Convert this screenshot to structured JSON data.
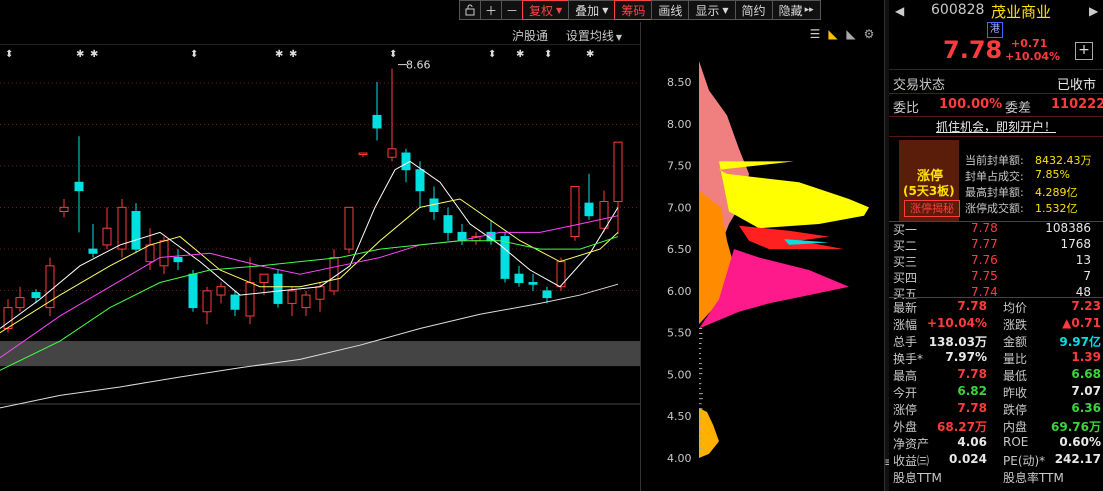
{
  "toolbar": {
    "buttons": [
      {
        "label": "复权",
        "dropdown": true,
        "highlight": true
      },
      {
        "label": "叠加",
        "dropdown": true,
        "highlight": false
      },
      {
        "label": "筹码",
        "dropdown": false,
        "highlight": true
      },
      {
        "label": "画线",
        "dropdown": false,
        "highlight": false
      },
      {
        "label": "显示",
        "dropdown": true,
        "highlight": false
      },
      {
        "label": "简约",
        "dropdown": false,
        "highlight": false
      },
      {
        "label": "隐藏",
        "dropdown": false,
        "highlight": false
      }
    ],
    "more_glyph": "▸▸"
  },
  "chart_header": {
    "hsgt_label": "沪股通",
    "ma_settings_label": "设置均线"
  },
  "annotations": {
    "high_price_label": "8.66"
  },
  "chart_data": {
    "type": "candlestick",
    "price_axis": [
      "8.50",
      "8.00",
      "7.50",
      "7.00",
      "6.50",
      "6.00",
      "5.50",
      "5.00",
      "4.50",
      "4.00"
    ],
    "ylim": [
      3.9,
      8.8
    ],
    "colors": {
      "up": "#ff3b3b",
      "down": "#00e0e0",
      "ma5": "#ffffff",
      "ma10": "#ffff66",
      "ma20": "#ff44ff",
      "ma30": "#44ff44",
      "ma60": "#dddddd",
      "band": "#444444"
    }
  },
  "stock": {
    "code": "600828",
    "name": "茂业商业",
    "tag": "港",
    "price": "7.78",
    "change": "+0.71",
    "change_pct": "+10.04%"
  },
  "status": {
    "label": "交易状态",
    "value": "已收市"
  },
  "order_ratio": {
    "ratio_label": "委比",
    "ratio_value": "100.00%",
    "diff_label": "委差",
    "diff_value": "110222"
  },
  "promo": "抓住机会，即刻开户！",
  "limit_up": {
    "title": "涨停",
    "subtitle": "(5天3板)",
    "button": "涨停揭秘",
    "items": [
      {
        "label": "当前封单额:",
        "value": "8432.43万"
      },
      {
        "label": "封单占成交:",
        "value": "7.85%"
      },
      {
        "label": "最高封单额:",
        "value": "4.289亿"
      },
      {
        "label": "涨停成交额:",
        "value": "1.532亿"
      }
    ]
  },
  "bids": [
    {
      "label": "买一",
      "price": "7.78",
      "vol": "108386"
    },
    {
      "label": "买二",
      "price": "7.77",
      "vol": "1768"
    },
    {
      "label": "买三",
      "price": "7.76",
      "vol": "13"
    },
    {
      "label": "买四",
      "price": "7.75",
      "vol": "7"
    },
    {
      "label": "买五",
      "price": "7.74",
      "vol": "48"
    }
  ],
  "quote": [
    {
      "l1": "最新",
      "v1": "7.78",
      "c1": "red",
      "l2": "均价",
      "v2": "7.23",
      "c2": "red"
    },
    {
      "l1": "涨幅",
      "v1": "+10.04%",
      "c1": "red",
      "l2": "涨跌",
      "v2": "▲0.71",
      "c2": "red"
    },
    {
      "l1": "总手",
      "v1": "138.03万",
      "c1": "white",
      "l2": "金额",
      "v2": "9.97亿",
      "c2": "cyan"
    },
    {
      "l1": "换手*",
      "v1": "7.97%",
      "c1": "white",
      "l2": "量比",
      "v2": "1.39",
      "c2": "red"
    },
    {
      "l1": "最高",
      "v1": "7.78",
      "c1": "red",
      "l2": "最低",
      "v2": "6.68",
      "c2": "green"
    },
    {
      "l1": "今开",
      "v1": "6.82",
      "c1": "green",
      "l2": "昨收",
      "v2": "7.07",
      "c2": "white"
    },
    {
      "l1": "涨停",
      "v1": "7.78",
      "c1": "red",
      "l2": "跌停",
      "v2": "6.36",
      "c2": "green"
    },
    {
      "l1": "外盘",
      "v1": "68.27万",
      "c1": "red",
      "l2": "内盘",
      "v2": "69.76万",
      "c2": "green"
    },
    {
      "l1": "净资产",
      "v1": "4.06",
      "c1": "white",
      "l2": "ROE",
      "v2": "0.60%",
      "c2": "white"
    },
    {
      "l1": "收益㈢",
      "v1": "0.024",
      "c1": "white",
      "l2": "PE(动)*",
      "v2": "242.17",
      "c2": "white"
    },
    {
      "l1": "股息TTM",
      "v1": "",
      "c1": "white",
      "l2": "股息率TTM",
      "v2": "",
      "c2": "white"
    }
  ]
}
